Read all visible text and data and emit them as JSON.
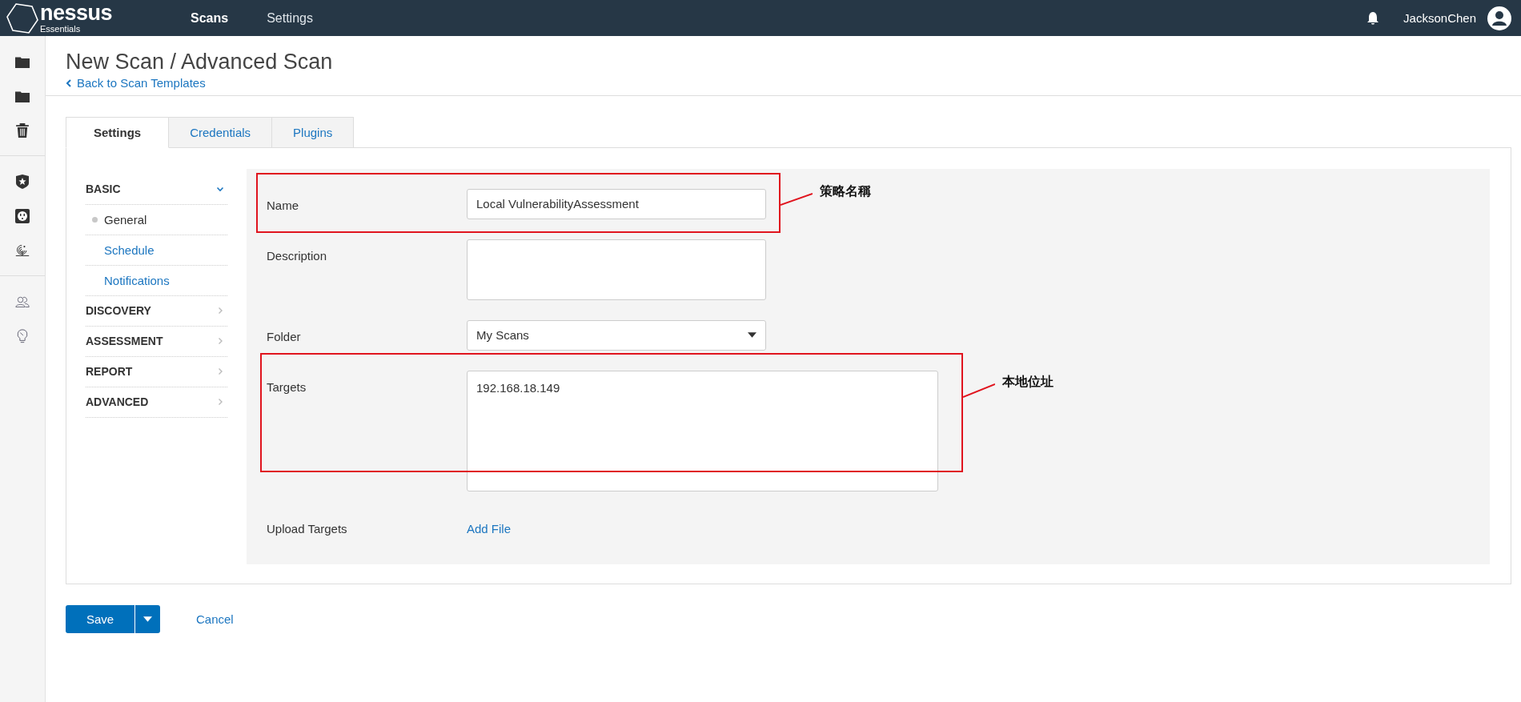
{
  "top_bar": {
    "logo": {
      "name": "nessus",
      "edition": "Essentials"
    },
    "nav": [
      {
        "label": "Scans",
        "selected": true
      },
      {
        "label": "Settings",
        "selected": false
      }
    ],
    "user": "JacksonChen"
  },
  "page": {
    "title": "New Scan / Advanced Scan",
    "back_link": "Back to Scan Templates"
  },
  "tabs": [
    {
      "label": "Settings",
      "selected": true
    },
    {
      "label": "Credentials",
      "selected": false
    },
    {
      "label": "Plugins",
      "selected": false
    }
  ],
  "side_nav": [
    {
      "label": "BASIC",
      "expanded": true,
      "children": [
        {
          "label": "General",
          "selected": true
        },
        {
          "label": "Schedule",
          "selected": false
        },
        {
          "label": "Notifications",
          "selected": false
        }
      ]
    },
    {
      "label": "DISCOVERY",
      "expanded": false
    },
    {
      "label": "ASSESSMENT",
      "expanded": false
    },
    {
      "label": "REPORT",
      "expanded": false
    },
    {
      "label": "ADVANCED",
      "expanded": false
    }
  ],
  "form": {
    "fields": [
      {
        "kind": "text",
        "label": "Name",
        "value": "Local VulnerabilityAssessment"
      },
      {
        "kind": "textarea",
        "label": "Description"
      },
      {
        "kind": "select",
        "label": "Folder",
        "value": "My Scans"
      },
      {
        "kind": "tall-textarea",
        "label": "Targets",
        "value": "192.168.18.149"
      },
      {
        "kind": "upload",
        "label": "Upload Targets",
        "link": "Add File"
      }
    ],
    "annotations": [
      {
        "text": "策略名稱"
      },
      {
        "text": "本地位址"
      }
    ]
  },
  "actions": {
    "save": "Save",
    "cancel": "Cancel"
  }
}
